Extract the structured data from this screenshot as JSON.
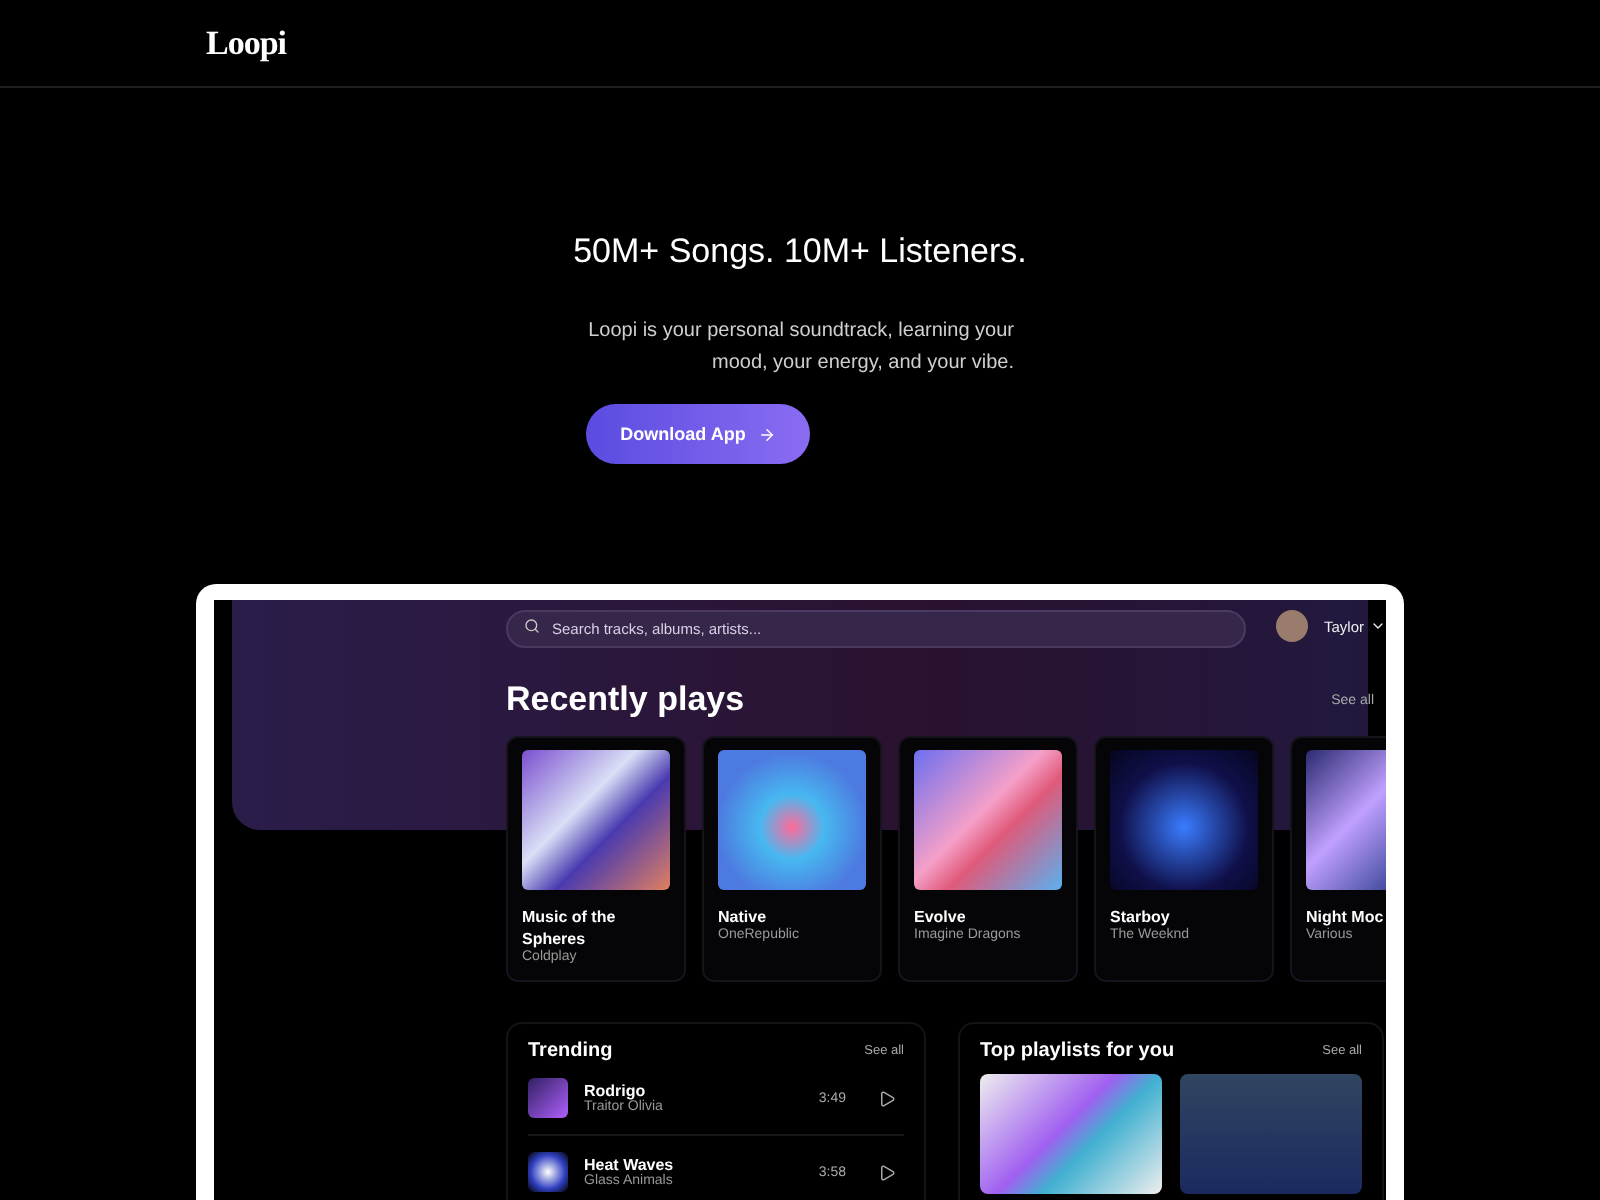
{
  "logo": "Loopi",
  "hero": {
    "title": "50M+ Songs. 10M+ Listeners.",
    "description": "Loopi is your personal soundtrack, learning your mood, your energy, and your vibe.",
    "button": "Download App"
  },
  "app": {
    "search": {
      "placeholder": "Search tracks, albums, artists..."
    },
    "user": {
      "name": "Taylor"
    },
    "recent": {
      "title": "Recently plays",
      "see_all": "See all",
      "items": [
        {
          "title": "Music of the Spheres",
          "artist": "Coldplay"
        },
        {
          "title": "Native",
          "artist": "OneRepublic"
        },
        {
          "title": "Evolve",
          "artist": "Imagine Dragons"
        },
        {
          "title": "Starboy",
          "artist": "The Weeknd"
        },
        {
          "title": "Night Moc",
          "artist": "Various"
        }
      ]
    },
    "trending": {
      "title": "Trending",
      "see_all": "See all",
      "tracks": [
        {
          "title": "Rodrigo",
          "artist": "Traitor Olivia",
          "duration": "3:49"
        },
        {
          "title": "Heat Waves",
          "artist": "Glass Animals",
          "duration": "3:58"
        }
      ]
    },
    "playlists": {
      "title": "Top playlists for you",
      "see_all": "See all"
    }
  }
}
